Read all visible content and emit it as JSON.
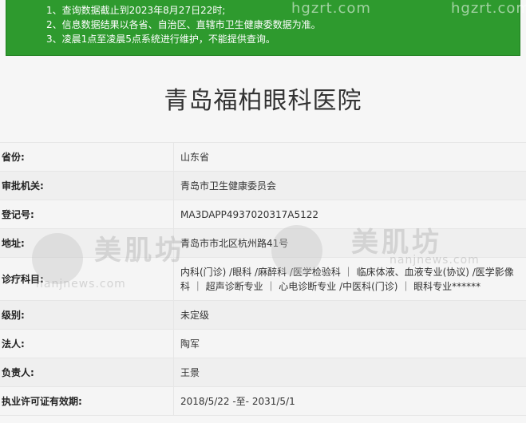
{
  "notice": {
    "lines": [
      "1、查询数据截止到2023年8月27日22时;",
      "2、信息数据结果以各省、自治区、直辖市卫生健康委数据为准。",
      "3、凌晨1点至凌晨5点系统进行维护，不能提供查询。"
    ]
  },
  "title": "青岛福柏眼科医院",
  "rows": [
    {
      "label": "省份:",
      "value": "山东省"
    },
    {
      "label": "审批机关:",
      "value": "青岛市卫生健康委员会"
    },
    {
      "label": "登记号:",
      "value": "MA3DAPP4937020317A5122"
    },
    {
      "label": "地址:",
      "value": "青岛市市北区杭州路41号"
    },
    {
      "label": "诊疗科目:",
      "value": "内科(门诊) /眼科 /麻醉科 /医学检验科 ｜ 临床体液、血液专业(协议) /医学影像科 ｜ 超声诊断专业 ｜ 心电诊断专业 /中医科(门诊) ｜ 眼科专业******"
    },
    {
      "label": "级别:",
      "value": "未定级"
    },
    {
      "label": "法人:",
      "value": "陶军"
    },
    {
      "label": "负责人:",
      "value": "王景"
    },
    {
      "label": "执业许可证有效期:",
      "value": "2018/5/22 -至- 2031/5/1"
    }
  ],
  "watermarks": {
    "brand": "美肌坊",
    "site_top_a": "hgzrt.com",
    "site_top_b": "hgzrt.com",
    "site_mid": "nanjnews.com"
  }
}
